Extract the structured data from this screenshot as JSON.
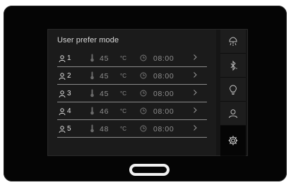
{
  "panel": {
    "title": "User prefer mode",
    "temp_unit": "°C",
    "rows": [
      {
        "user": "1",
        "temp": "45",
        "time": "08:00"
      },
      {
        "user": "2",
        "temp": "45",
        "time": "08:00"
      },
      {
        "user": "3",
        "temp": "45",
        "time": "08:00"
      },
      {
        "user": "4",
        "temp": "46",
        "time": "08:00"
      },
      {
        "user": "5",
        "temp": "48",
        "time": "08:00"
      }
    ]
  },
  "sidebar": {
    "items": [
      {
        "icon": "shower-icon",
        "active": false
      },
      {
        "icon": "bluetooth-icon",
        "active": false
      },
      {
        "icon": "lightbulb-icon",
        "active": false
      },
      {
        "icon": "user-icon",
        "active": false
      },
      {
        "icon": "gear-icon",
        "active": true
      }
    ]
  },
  "colors": {
    "device": "#050505",
    "panel": "#1b1b1b",
    "text": "#d8d8d8",
    "muted": "#8f8f8f",
    "divider": "#8a8a8a"
  }
}
